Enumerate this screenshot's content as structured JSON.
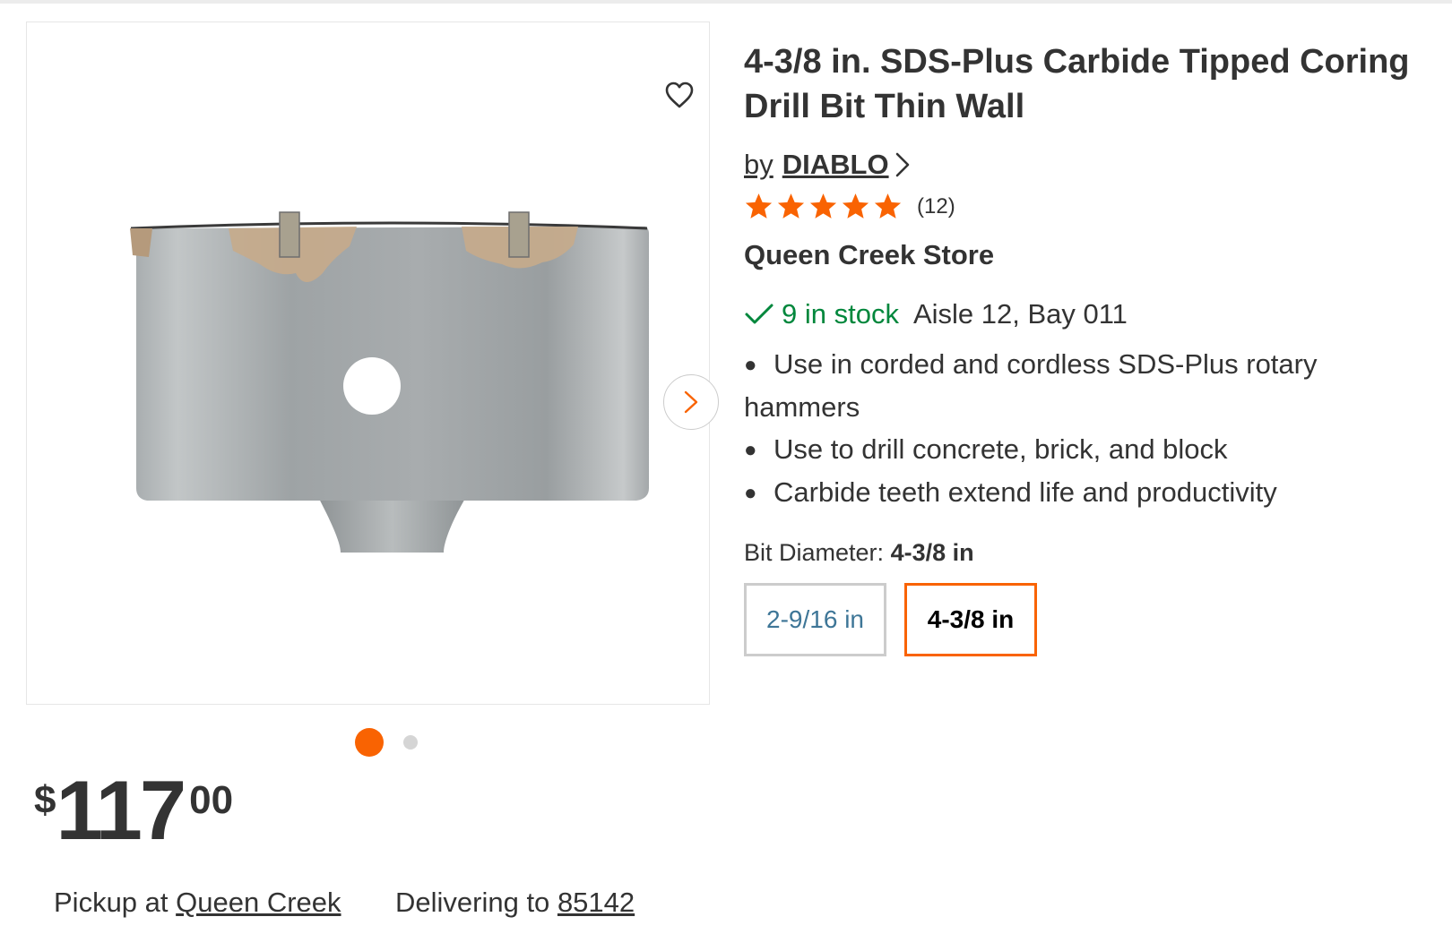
{
  "product": {
    "title": "4-3/8 in. SDS-Plus Carbide Tipped Coring Drill Bit Thin Wall",
    "brand_prefix": "by",
    "brand": "DIABLO",
    "rating": {
      "stars": 5,
      "count_label": "(12)"
    },
    "store_name": "Queen Creek Store",
    "stock": {
      "quantity_label": "9 in stock",
      "location": "Aisle 12, Bay 011"
    },
    "bullets": [
      "Use in corded and cordless SDS-Plus rotary hammers",
      "Use to drill concrete, brick, and block",
      "Carbide teeth extend life and productivity"
    ],
    "variant": {
      "label": "Bit Diameter:",
      "selected": "4-3/8 in",
      "options": [
        "2-9/16 in",
        "4-3/8 in"
      ]
    }
  },
  "gallery": {
    "image_count": 2,
    "active_index": 0,
    "favorite_icon": "heart-outline-icon",
    "next_icon": "chevron-right-icon"
  },
  "price": {
    "currency": "$",
    "dollars": "117",
    "cents": "00"
  },
  "fulfillment": {
    "pickup_prefix": "Pickup at",
    "pickup_store": "Queen Creek",
    "delivery_prefix": "Delivering to",
    "delivery_zip": "85142"
  },
  "colors": {
    "accent": "#f96302",
    "in_stock": "#00873c",
    "link_blue": "#3e7697",
    "text": "#333333"
  }
}
